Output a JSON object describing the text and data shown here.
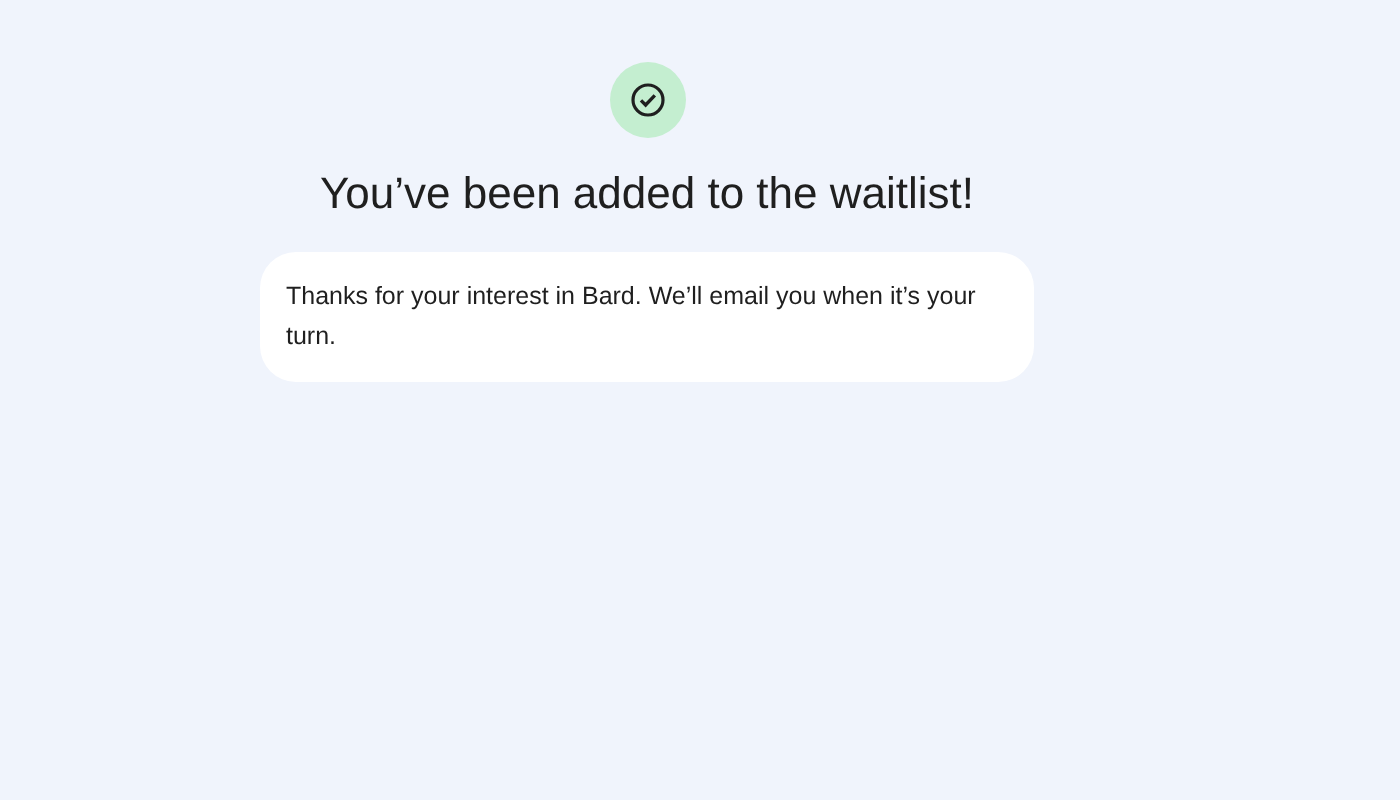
{
  "title": "You’ve been added to the waitlist!",
  "message": "Thanks for your interest in Bard. We’ll email you when it’s your turn."
}
